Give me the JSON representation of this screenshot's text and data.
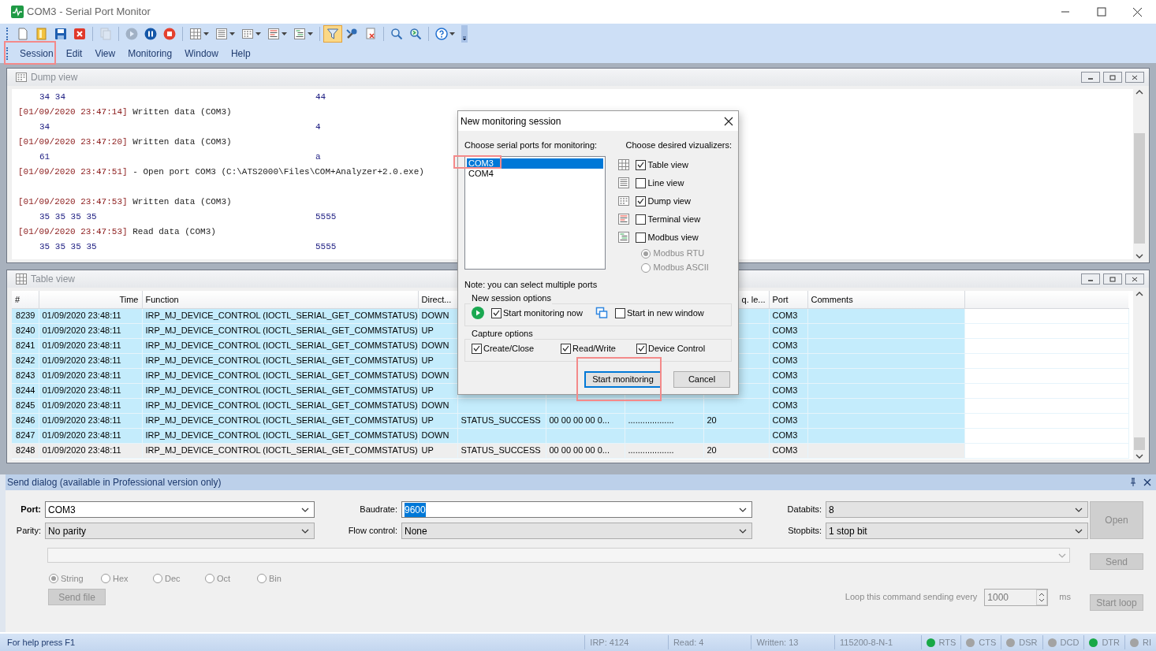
{
  "window": {
    "title": "COM3 - Serial Port Monitor"
  },
  "toolbar": [
    [
      {
        "kind": "new",
        "selected": false,
        "disabled": false,
        "dropdown": false
      },
      {
        "kind": "open",
        "selected": false,
        "disabled": false,
        "dropdown": false
      },
      {
        "kind": "save",
        "selected": false,
        "disabled": false,
        "dropdown": false
      },
      {
        "kind": "close",
        "selected": false,
        "disabled": false,
        "dropdown": false
      }
    ],
    [
      {
        "kind": "copy",
        "selected": false,
        "disabled": true,
        "dropdown": false
      }
    ],
    [
      {
        "kind": "play",
        "selected": false,
        "disabled": true,
        "dropdown": false
      },
      {
        "kind": "pause",
        "selected": false,
        "disabled": false,
        "dropdown": false
      },
      {
        "kind": "stop",
        "selected": false,
        "disabled": false,
        "dropdown": false
      }
    ],
    [
      {
        "kind": "table",
        "selected": false,
        "disabled": false,
        "dropdown": true
      },
      {
        "kind": "line",
        "selected": false,
        "disabled": false,
        "dropdown": true
      },
      {
        "kind": "dump",
        "selected": false,
        "disabled": false,
        "dropdown": true
      },
      {
        "kind": "terminal",
        "selected": false,
        "disabled": false,
        "dropdown": true
      },
      {
        "kind": "modbus",
        "selected": false,
        "disabled": false,
        "dropdown": true
      }
    ],
    [
      {
        "kind": "filter",
        "selected": true,
        "disabled": false,
        "dropdown": false
      },
      {
        "kind": "tools",
        "selected": false,
        "disabled": false,
        "dropdown": false
      },
      {
        "kind": "clear",
        "selected": false,
        "disabled": false,
        "dropdown": false
      }
    ],
    [
      {
        "kind": "search",
        "selected": false,
        "disabled": false,
        "dropdown": false
      },
      {
        "kind": "search-next",
        "selected": false,
        "disabled": false,
        "dropdown": false
      }
    ],
    [
      {
        "kind": "help",
        "selected": false,
        "disabled": false,
        "dropdown": true
      }
    ]
  ],
  "menu": [
    {
      "label": "Session",
      "highlighted": true
    },
    {
      "label": "Edit",
      "highlighted": false
    },
    {
      "label": "View",
      "highlighted": false
    },
    {
      "label": "Monitoring",
      "highlighted": false
    },
    {
      "label": "Window",
      "highlighted": false
    },
    {
      "label": "Help",
      "highlighted": false
    }
  ],
  "dump_view": {
    "title": "Dump view",
    "lines": [
      {
        "kind": "hex",
        "hex": "34 34",
        "ascii": "44"
      },
      {
        "kind": "event",
        "time": "[01/09/2020 23:47:14]",
        "text": "Written data (COM3)"
      },
      {
        "kind": "hex",
        "hex": "34",
        "ascii": "4"
      },
      {
        "kind": "event",
        "time": "[01/09/2020 23:47:20]",
        "text": "Written data (COM3)"
      },
      {
        "kind": "hex",
        "hex": "61",
        "ascii": "a"
      },
      {
        "kind": "event",
        "time": "[01/09/2020 23:47:51]",
        "text": "- Open port COM3 (C:\\ATS2000\\Files\\COM+Analyzer+2.0.exe)"
      },
      {
        "kind": "blank"
      },
      {
        "kind": "event",
        "time": "[01/09/2020 23:47:53]",
        "text": "Written data (COM3)"
      },
      {
        "kind": "hex",
        "hex": "35 35 35 35",
        "ascii": "5555"
      },
      {
        "kind": "event",
        "time": "[01/09/2020 23:47:53]",
        "text": "Read data (COM3)"
      },
      {
        "kind": "hex",
        "hex": "35 35 35 35",
        "ascii": "5555"
      }
    ]
  },
  "table_view": {
    "title": "Table view",
    "columns": [
      "#",
      "Time",
      "Function",
      "Direct...",
      "q. le...",
      "Port",
      "Comments"
    ],
    "rows": [
      {
        "num": "8239",
        "time": "01/09/2020 23:48:11",
        "function": "IRP_MJ_DEVICE_CONTROL (IOCTL_SERIAL_GET_COMMSTATUS)",
        "direction": "DOWN",
        "port": "COM3",
        "selected": false
      },
      {
        "num": "8240",
        "time": "01/09/2020 23:48:11",
        "function": "IRP_MJ_DEVICE_CONTROL (IOCTL_SERIAL_GET_COMMSTATUS)",
        "direction": "UP",
        "port": "COM3",
        "selected": false
      },
      {
        "num": "8241",
        "time": "01/09/2020 23:48:11",
        "function": "IRP_MJ_DEVICE_CONTROL (IOCTL_SERIAL_GET_COMMSTATUS)",
        "direction": "DOWN",
        "port": "COM3",
        "selected": false
      },
      {
        "num": "8242",
        "time": "01/09/2020 23:48:11",
        "function": "IRP_MJ_DEVICE_CONTROL (IOCTL_SERIAL_GET_COMMSTATUS)",
        "direction": "UP",
        "port": "COM3",
        "selected": false
      },
      {
        "num": "8243",
        "time": "01/09/2020 23:48:11",
        "function": "IRP_MJ_DEVICE_CONTROL (IOCTL_SERIAL_GET_COMMSTATUS)",
        "direction": "DOWN",
        "port": "COM3",
        "selected": false
      },
      {
        "num": "8244",
        "time": "01/09/2020 23:48:11",
        "function": "IRP_MJ_DEVICE_CONTROL (IOCTL_SERIAL_GET_COMMSTATUS)",
        "direction": "UP",
        "port": "COM3",
        "selected": false
      },
      {
        "num": "8245",
        "time": "01/09/2020 23:48:11",
        "function": "IRP_MJ_DEVICE_CONTROL (IOCTL_SERIAL_GET_COMMSTATUS)",
        "direction": "DOWN",
        "port": "COM3",
        "selected": false
      },
      {
        "num": "8246",
        "time": "01/09/2020 23:48:11",
        "function": "IRP_MJ_DEVICE_CONTROL (IOCTL_SERIAL_GET_COMMSTATUS)",
        "direction": "UP",
        "status": "STATUS_SUCCESS",
        "data": "00 00 00 00 0...",
        "ascii": "...................",
        "length": "20",
        "port": "COM3",
        "selected": false
      },
      {
        "num": "8247",
        "time": "01/09/2020 23:48:11",
        "function": "IRP_MJ_DEVICE_CONTROL (IOCTL_SERIAL_GET_COMMSTATUS)",
        "direction": "DOWN",
        "port": "COM3",
        "selected": false
      },
      {
        "num": "8248",
        "time": "01/09/2020 23:48:11",
        "function": "IRP_MJ_DEVICE_CONTROL (IOCTL_SERIAL_GET_COMMSTATUS)",
        "direction": "UP",
        "status": "STATUS_SUCCESS",
        "data": "00 00 00 00 0...",
        "ascii": "...................",
        "length": "20",
        "port": "COM3",
        "selected": true
      }
    ]
  },
  "dialog": {
    "title": "New monitoring session",
    "ports_label": "Choose serial ports for monitoring:",
    "ports": [
      {
        "label": "COM3",
        "selected": true,
        "highlighted": true
      },
      {
        "label": "COM4",
        "selected": false,
        "highlighted": false
      }
    ],
    "visualizers_label": "Choose desired vizualizers:",
    "visualizers": [
      {
        "kind": "table",
        "label": "Table view",
        "checked": true
      },
      {
        "kind": "line",
        "label": "Line view",
        "checked": false
      },
      {
        "kind": "dump",
        "label": "Dump view",
        "checked": true
      },
      {
        "kind": "terminal",
        "label": "Terminal view",
        "checked": false
      },
      {
        "kind": "modbus",
        "label": "Modbus view",
        "checked": false
      }
    ],
    "modbus_modes": [
      {
        "label": "Modbus RTU",
        "selected": true
      },
      {
        "label": "Modbus ASCII",
        "selected": false
      }
    ],
    "note": "Note: you can select multiple ports",
    "session_options": {
      "title": "New session options",
      "items": [
        {
          "kind": "play",
          "label": "Start monitoring now",
          "checked": true
        },
        {
          "kind": "window",
          "label": "Start in new window",
          "checked": false
        }
      ]
    },
    "capture_options": {
      "title": "Capture options",
      "items": [
        {
          "label": "Create/Close",
          "checked": true
        },
        {
          "label": "Read/Write",
          "checked": true
        },
        {
          "label": "Device Control",
          "checked": true
        }
      ]
    },
    "buttons": [
      {
        "label": "Start monitoring",
        "default": true,
        "highlighted": true
      },
      {
        "label": "Cancel",
        "default": false,
        "highlighted": false
      }
    ]
  },
  "send_dialog": {
    "title": "Send dialog (available in Professional version only)",
    "fields": [
      {
        "label": "Port:",
        "value": "COM3",
        "disabled": false,
        "text_selected": false
      },
      {
        "label": "Baudrate:",
        "value": "9600",
        "disabled": false,
        "text_selected": true
      },
      {
        "label": "Databits:",
        "value": "8",
        "disabled": true,
        "text_selected": false
      },
      {
        "label": "Parity:",
        "value": "No parity",
        "disabled": true,
        "text_selected": false
      },
      {
        "label": "Flow control:",
        "value": "None",
        "disabled": true,
        "text_selected": false
      },
      {
        "label": "Stopbits:",
        "value": "1 stop bit",
        "disabled": true,
        "text_selected": false
      }
    ],
    "formats": [
      {
        "label": "String",
        "selected": true
      },
      {
        "label": "Hex",
        "selected": false
      },
      {
        "label": "Dec",
        "selected": false
      },
      {
        "label": "Oct",
        "selected": false
      },
      {
        "label": "Bin",
        "selected": false
      }
    ],
    "send_file": {
      "label": "Send file",
      "disabled": true
    },
    "loop_label": "Loop this command sending every",
    "loop_value": "1000",
    "loop_unit": "ms",
    "open": {
      "label": "Open",
      "disabled": true
    },
    "send": {
      "label": "Send",
      "disabled": true
    },
    "start_loop": {
      "label": "Start loop",
      "disabled": true
    }
  },
  "status_bar": {
    "help": "For help press F1",
    "sections": [
      "IRP: 4124",
      "Read: 4",
      "Written: 13",
      "115200-8-N-1"
    ],
    "lines": [
      {
        "label": "RTS",
        "on": true
      },
      {
        "label": "CTS",
        "on": false
      },
      {
        "label": "DSR",
        "on": false
      },
      {
        "label": "DCD",
        "on": false
      },
      {
        "label": "DTR",
        "on": true
      },
      {
        "label": "RI",
        "on": false
      }
    ]
  }
}
